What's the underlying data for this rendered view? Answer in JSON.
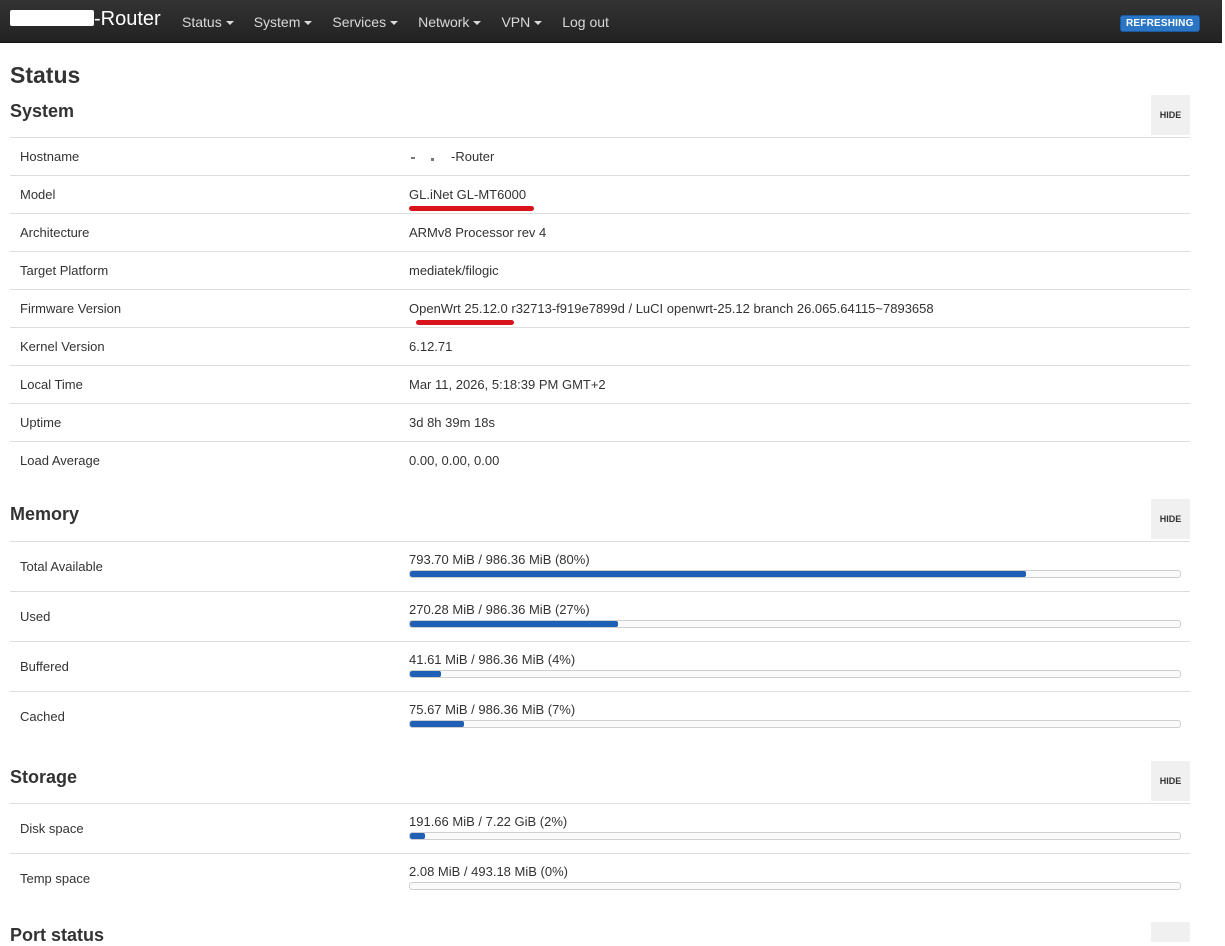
{
  "navbar": {
    "brand_suffix": "-Router",
    "menu": [
      {
        "label": "Status",
        "dropdown": true
      },
      {
        "label": "System",
        "dropdown": true
      },
      {
        "label": "Services",
        "dropdown": true
      },
      {
        "label": "Network",
        "dropdown": true
      },
      {
        "label": "VPN",
        "dropdown": true
      },
      {
        "label": "Log out",
        "dropdown": false
      }
    ],
    "refresh_badge": "REFRESHING"
  },
  "page_title": "Status",
  "system": {
    "title": "System",
    "hide_label": "HIDE",
    "rows": [
      {
        "label": "Hostname",
        "value": "-Router"
      },
      {
        "label": "Model",
        "value": "GL.iNet GL-MT6000"
      },
      {
        "label": "Architecture",
        "value": "ARMv8 Processor rev 4"
      },
      {
        "label": "Target Platform",
        "value": "mediatek/filogic"
      },
      {
        "label": "Firmware Version",
        "value": "OpenWrt 25.12.0 r32713-f919e7899d / LuCI openwrt-25.12 branch 26.065.64115~7893658"
      },
      {
        "label": "Kernel Version",
        "value": "6.12.71"
      },
      {
        "label": "Local Time",
        "value": "Mar 11, 2026, 5:18:39 PM GMT+2"
      },
      {
        "label": "Uptime",
        "value": "3d 8h 39m 18s"
      },
      {
        "label": "Load Average",
        "value": "0.00, 0.00, 0.00"
      }
    ]
  },
  "memory": {
    "title": "Memory",
    "hide_label": "HIDE",
    "rows": [
      {
        "label": "Total Available",
        "text": "793.70 MiB / 986.36 MiB (80%)",
        "percent": 80
      },
      {
        "label": "Used",
        "text": "270.28 MiB / 986.36 MiB (27%)",
        "percent": 27
      },
      {
        "label": "Buffered",
        "text": "41.61 MiB / 986.36 MiB (4%)",
        "percent": 4
      },
      {
        "label": "Cached",
        "text": "75.67 MiB / 986.36 MiB (7%)",
        "percent": 7
      }
    ]
  },
  "storage": {
    "title": "Storage",
    "hide_label": "HIDE",
    "rows": [
      {
        "label": "Disk space",
        "text": "191.66 MiB / 7.22 GiB (2%)",
        "percent": 2
      },
      {
        "label": "Temp space",
        "text": "2.08 MiB / 493.18 MiB (0%)",
        "percent": 0
      }
    ]
  },
  "port_status": {
    "title": "Port status"
  },
  "colors": {
    "navbar_bg": "#222222",
    "accent": "#1f5fb5",
    "badge": "#2a75c4",
    "annotation": "#d8131b"
  }
}
